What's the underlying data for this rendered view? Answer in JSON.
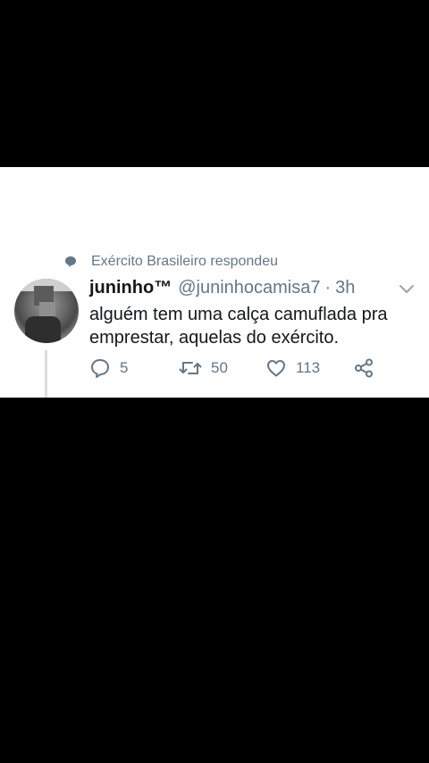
{
  "context": {
    "icon": "speech-bubble-icon",
    "text": "Exército Brasileiro respondeu"
  },
  "tweet": {
    "display_name": "juninho™",
    "handle": "@juninhocamisa7",
    "separator": "·",
    "time": "3h",
    "text_line1": "alguém tem uma calça camuflada pra",
    "text_line2": "emprestar, aquelas do exército."
  },
  "actions": {
    "replies": "5",
    "retweets": "50",
    "likes": "113"
  },
  "colors": {
    "background": "#000000",
    "card": "#fefefe",
    "text": "#14171a",
    "secondary": "#657786"
  }
}
